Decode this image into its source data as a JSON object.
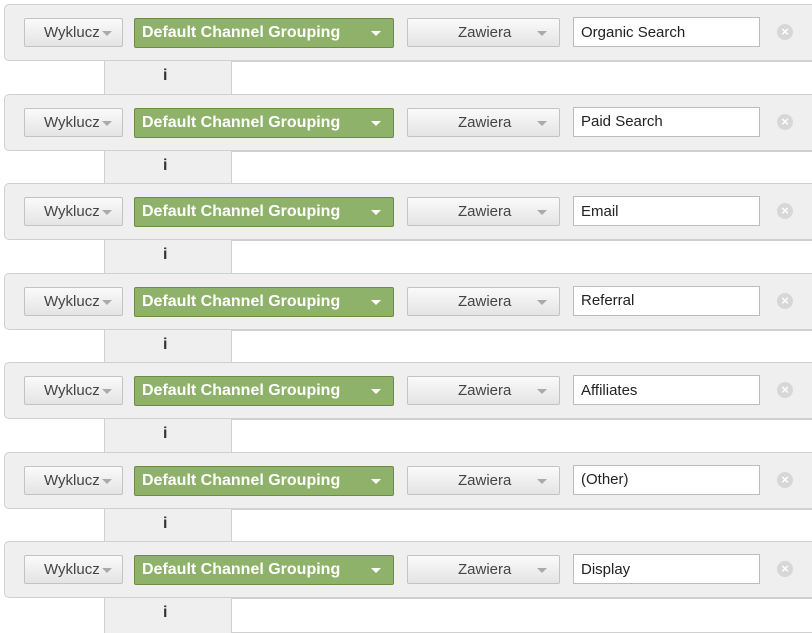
{
  "conditions": [
    {
      "mode_label": "Wyklucz",
      "dimension_label": "Default Channel Grouping",
      "operator_label": "Zawiera",
      "value": "Organic Search"
    },
    {
      "mode_label": "Wyklucz",
      "dimension_label": "Default Channel Grouping",
      "operator_label": "Zawiera",
      "value": "Paid Search"
    },
    {
      "mode_label": "Wyklucz",
      "dimension_label": "Default Channel Grouping",
      "operator_label": "Zawiera",
      "value": "Email"
    },
    {
      "mode_label": "Wyklucz",
      "dimension_label": "Default Channel Grouping",
      "operator_label": "Zawiera",
      "value": "Referral"
    },
    {
      "mode_label": "Wyklucz",
      "dimension_label": "Default Channel Grouping",
      "operator_label": "Zawiera",
      "value": "Affiliates"
    },
    {
      "mode_label": "Wyklucz",
      "dimension_label": "Default Channel Grouping",
      "operator_label": "Zawiera",
      "value": "(Other)"
    },
    {
      "mode_label": "Wyklucz",
      "dimension_label": "Default Channel Grouping",
      "operator_label": "Zawiera",
      "value": "Display"
    }
  ],
  "connector_label": "i",
  "colors": {
    "dimension_green": "#8fb26a",
    "row_background": "#efefef",
    "border_gray": "#d0d0d0"
  },
  "icons": {
    "remove": "close-circle-icon",
    "dropdown": "caret-down-icon"
  }
}
